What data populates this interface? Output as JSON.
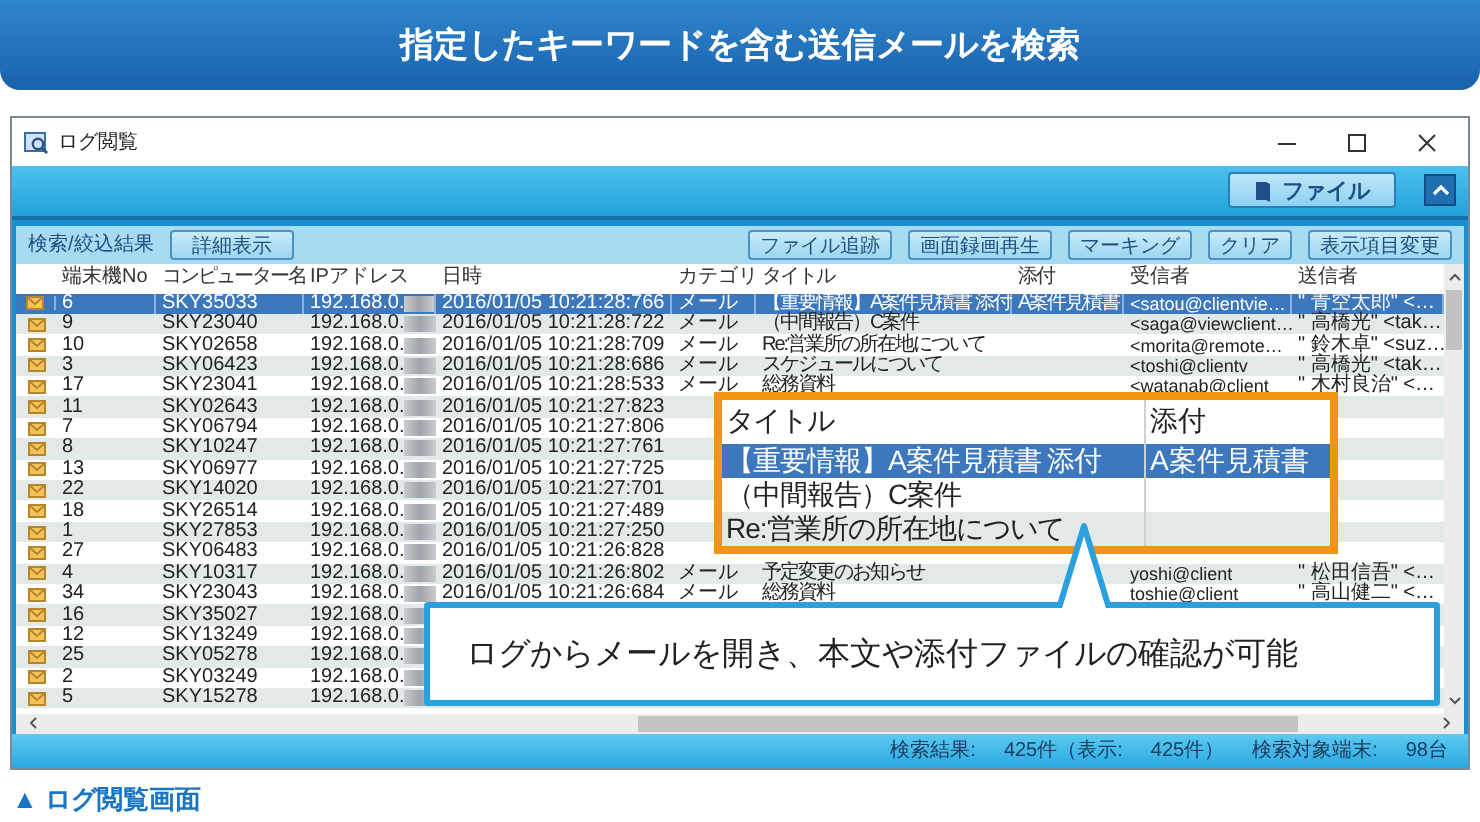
{
  "banner": {
    "title": "指定したキーワードを含む送信メールを検索"
  },
  "window": {
    "title": "ログ閲覧"
  },
  "ribbon": {
    "file_button": "ファイル"
  },
  "panel": {
    "title": "検索/絞込結果",
    "detail_button": "詳細表示",
    "buttons": [
      "ファイル追跡",
      "画面録画再生",
      "マーキング",
      "クリア",
      "表示項目変更"
    ]
  },
  "table": {
    "columns": [
      "端末機No",
      "コンピューター名",
      "IPアドレス",
      "日時",
      "カテゴリ",
      "タイトル",
      "添付",
      "受信者",
      "送信者"
    ],
    "rows": [
      {
        "selected": true,
        "no": "6",
        "computer": "SKY35033",
        "ip": "192.168.0.",
        "datetime": "2016/01/05 10:21:28:766",
        "category": "メール",
        "title": "【重要情報】A案件見積書 添付",
        "attachment": "A案件見積書",
        "recipient": "<satou@clientvie…",
        "sender": "\" 青空太郎\" <…"
      },
      {
        "selected": false,
        "no": "9",
        "computer": "SKY23040",
        "ip": "192.168.0.",
        "datetime": "2016/01/05 10:21:28:722",
        "category": "メール",
        "title": "（中間報告）C案件",
        "recipient": "<saga@viewclient…",
        "sender": "\" 高橋光\" <tak…"
      },
      {
        "selected": false,
        "no": "10",
        "computer": "SKY02658",
        "ip": "192.168.0.",
        "datetime": "2016/01/05 10:21:28:709",
        "category": "メール",
        "title": "Re:営業所の所在地について",
        "recipient": "<morita@remote…",
        "sender": "\" 鈴木卓\" <suz…"
      },
      {
        "selected": false,
        "no": "3",
        "computer": "SKY06423",
        "ip": "192.168.0.",
        "datetime": "2016/01/05 10:21:28:686",
        "category": "メール",
        "title": "スケジュールについて",
        "recipient": "<toshi@clientv",
        "sender": "\" 高橋光\" <tak…"
      },
      {
        "selected": false,
        "no": "17",
        "computer": "SKY23041",
        "ip": "192.168.0.",
        "datetime": "2016/01/05 10:21:28:533",
        "category": "メール",
        "title": "総務資料",
        "recipient": "<watanab@client",
        "sender": "\" 木村良治\" <…"
      },
      {
        "selected": false,
        "no": "11",
        "computer": "SKY02643",
        "ip": "192.168.0.",
        "datetime": "2016/01/05 10:21:27:823"
      },
      {
        "selected": false,
        "no": "7",
        "computer": "SKY06794",
        "ip": "192.168.0.",
        "datetime": "2016/01/05 10:21:27:806"
      },
      {
        "selected": false,
        "no": "8",
        "computer": "SKY10247",
        "ip": "192.168.0.",
        "datetime": "2016/01/05 10:21:27:761"
      },
      {
        "selected": false,
        "no": "13",
        "computer": "SKY06977",
        "ip": "192.168.0.",
        "datetime": "2016/01/05 10:21:27:725"
      },
      {
        "selected": false,
        "no": "22",
        "computer": "SKY14020",
        "ip": "192.168.0.",
        "datetime": "2016/01/05 10:21:27:701"
      },
      {
        "selected": false,
        "no": "18",
        "computer": "SKY26514",
        "ip": "192.168.0.",
        "datetime": "2016/01/05 10:21:27:489"
      },
      {
        "selected": false,
        "no": "1",
        "computer": "SKY27853",
        "ip": "192.168.0.",
        "datetime": "2016/01/05 10:21:27:250"
      },
      {
        "selected": false,
        "no": "27",
        "computer": "SKY06483",
        "ip": "192.168.0.",
        "datetime": "2016/01/05 10:21:26:828"
      },
      {
        "selected": false,
        "no": "4",
        "computer": "SKY10317",
        "ip": "192.168.0.",
        "datetime": "2016/01/05 10:21:26:802",
        "category": "メール",
        "title": "予定変更のお知らせ",
        "recipient": "yoshi@client",
        "sender": "\" 松田信吾\" <…"
      },
      {
        "selected": false,
        "no": "34",
        "computer": "SKY23043",
        "ip": "192.168.0.",
        "datetime": "2016/01/05 10:21:26:684",
        "category": "メール",
        "title": "総務資料",
        "recipient": "toshie@client",
        "sender": "\" 高山健二\" <…"
      },
      {
        "selected": false,
        "no": "16",
        "computer": "SKY35027",
        "ip": "192.168.0."
      },
      {
        "selected": false,
        "no": "12",
        "computer": "SKY13249",
        "ip": "192.168.0."
      },
      {
        "selected": false,
        "no": "25",
        "computer": "SKY05278",
        "ip": "192.168.0."
      },
      {
        "selected": false,
        "no": "2",
        "computer": "SKY03249",
        "ip": "192.168.0."
      },
      {
        "selected": false,
        "no": "5",
        "computer": "SKY15278",
        "ip": "192.168.0."
      }
    ]
  },
  "zoom_callout": {
    "columns": [
      "タイトル",
      "添付"
    ],
    "rows": [
      {
        "selected": true,
        "title": "【重要情報】A案件見積書 添付",
        "attachment": "A案件見積書"
      },
      {
        "selected": false,
        "title": "（中間報告）C案件"
      },
      {
        "selected": false,
        "title": "Re:営業所の所在地について"
      }
    ]
  },
  "bubble": {
    "text": "ログからメールを開き、本文や添付ファイルの確認が可能"
  },
  "status_bar": {
    "items": [
      "検索結果:",
      "425件（表示:",
      "425件）",
      "検索対象端末:",
      "98台"
    ]
  },
  "caption": "▲ ログ閲覧画面"
}
